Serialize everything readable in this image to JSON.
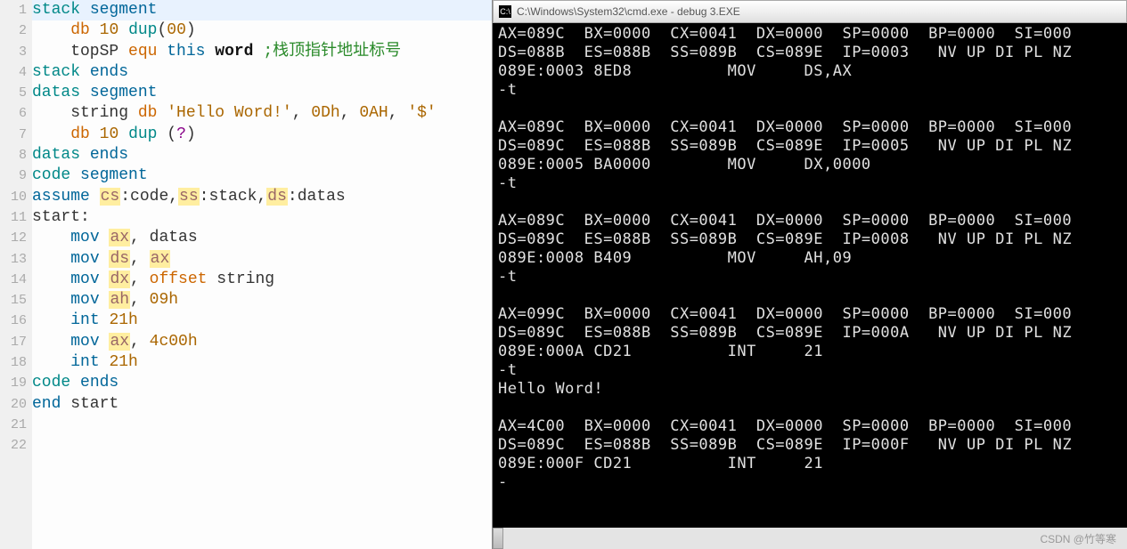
{
  "editor": {
    "gutter_start": 1,
    "gutter_count": 22,
    "lines": [
      {
        "hl": true,
        "tokens": [
          [
            "stack ",
            "kw-teal"
          ],
          [
            "segment",
            "kw-blue"
          ]
        ]
      },
      {
        "tokens": [
          [
            "    ",
            ""
          ],
          [
            "db",
            "kw-orange"
          ],
          [
            " ",
            ""
          ],
          [
            "10",
            "num"
          ],
          [
            " ",
            ""
          ],
          [
            "dup",
            "kw-teal"
          ],
          [
            "(",
            ""
          ],
          [
            "00",
            "num"
          ],
          [
            ")",
            ""
          ]
        ]
      },
      {
        "tokens": [
          [
            "    topSP ",
            ""
          ],
          [
            "equ",
            "kw-orange"
          ],
          [
            " ",
            ""
          ],
          [
            "this",
            "kw-blue"
          ],
          [
            " ",
            ""
          ],
          [
            "word",
            "kw-bold"
          ],
          [
            " ",
            ""
          ],
          [
            ";栈顶指针地址标号",
            "cmt"
          ]
        ]
      },
      {
        "tokens": [
          [
            "stack ",
            "kw-teal"
          ],
          [
            "ends",
            "kw-blue"
          ]
        ]
      },
      {
        "tokens": [
          [
            "datas ",
            "kw-teal"
          ],
          [
            "segment",
            "kw-blue"
          ]
        ]
      },
      {
        "tokens": [
          [
            "    string ",
            ""
          ],
          [
            "db",
            "kw-orange"
          ],
          [
            " ",
            ""
          ],
          [
            "'Hello Word!'",
            "str"
          ],
          [
            ", ",
            ""
          ],
          [
            "0Dh",
            "num"
          ],
          [
            ", ",
            ""
          ],
          [
            "0AH",
            "num"
          ],
          [
            ", ",
            ""
          ],
          [
            "'$'",
            "str"
          ]
        ]
      },
      {
        "tokens": [
          [
            "    ",
            ""
          ],
          [
            "db",
            "kw-orange"
          ],
          [
            " ",
            ""
          ],
          [
            "10",
            "num"
          ],
          [
            " ",
            ""
          ],
          [
            "dup",
            "kw-teal"
          ],
          [
            " (",
            ""
          ],
          [
            "?",
            "kw-purple"
          ],
          [
            ")",
            ""
          ]
        ]
      },
      {
        "tokens": [
          [
            "datas ",
            "kw-teal"
          ],
          [
            "ends",
            "kw-blue"
          ]
        ]
      },
      {
        "tokens": [
          [
            "code ",
            "kw-teal"
          ],
          [
            "segment",
            "kw-blue"
          ]
        ]
      },
      {
        "tokens": [
          [
            "assume",
            "kw-blue"
          ],
          [
            " ",
            ""
          ],
          [
            "cs",
            "hl-reg kw-brown"
          ],
          [
            ":code,",
            ""
          ],
          [
            "ss",
            "hl-reg kw-brown"
          ],
          [
            ":stack,",
            ""
          ],
          [
            "ds",
            "hl-reg kw-brown"
          ],
          [
            ":datas",
            ""
          ]
        ]
      },
      {
        "tokens": [
          [
            "start:",
            ""
          ]
        ]
      },
      {
        "tokens": [
          [
            "    ",
            ""
          ],
          [
            "mov",
            "kw-blue"
          ],
          [
            " ",
            ""
          ],
          [
            "ax",
            "hl-reg kw-brown"
          ],
          [
            ", datas",
            ""
          ]
        ]
      },
      {
        "tokens": [
          [
            "    ",
            ""
          ],
          [
            "mov",
            "kw-blue"
          ],
          [
            " ",
            ""
          ],
          [
            "ds",
            "hl-reg kw-brown"
          ],
          [
            ", ",
            ""
          ],
          [
            "ax",
            "hl-reg kw-brown"
          ]
        ]
      },
      {
        "tokens": [
          [
            "    ",
            ""
          ],
          [
            "mov",
            "kw-blue"
          ],
          [
            " ",
            ""
          ],
          [
            "dx",
            "hl-reg kw-brown"
          ],
          [
            ", ",
            ""
          ],
          [
            "offset",
            "kw-orange"
          ],
          [
            " string",
            ""
          ]
        ]
      },
      {
        "tokens": [
          [
            "    ",
            ""
          ],
          [
            "mov",
            "kw-blue"
          ],
          [
            " ",
            ""
          ],
          [
            "ah",
            "hl-reg kw-brown"
          ],
          [
            ", ",
            ""
          ],
          [
            "09h",
            "num"
          ]
        ]
      },
      {
        "tokens": [
          [
            "    ",
            ""
          ],
          [
            "int",
            "kw-blue"
          ],
          [
            " ",
            ""
          ],
          [
            "21h",
            "num"
          ]
        ]
      },
      {
        "tokens": [
          [
            "    ",
            ""
          ],
          [
            "mov",
            "kw-blue"
          ],
          [
            " ",
            ""
          ],
          [
            "ax",
            "hl-reg kw-brown"
          ],
          [
            ", ",
            ""
          ],
          [
            "4c00h",
            "num"
          ]
        ]
      },
      {
        "tokens": [
          [
            "    ",
            ""
          ],
          [
            "int",
            "kw-blue"
          ],
          [
            " ",
            ""
          ],
          [
            "21h",
            "num"
          ]
        ]
      },
      {
        "tokens": [
          [
            "code ",
            "kw-teal"
          ],
          [
            "ends",
            "kw-blue"
          ]
        ]
      },
      {
        "tokens": [
          [
            "end",
            "kw-blue"
          ],
          [
            " start",
            ""
          ]
        ]
      },
      {
        "tokens": [
          [
            "",
            ""
          ]
        ]
      },
      {
        "tokens": [
          [
            "",
            ""
          ]
        ]
      }
    ]
  },
  "console": {
    "title_icon_text": "C:\\",
    "title": "C:\\Windows\\System32\\cmd.exe - debug  3.EXE",
    "lines": [
      "AX=089C  BX=0000  CX=0041  DX=0000  SP=0000  BP=0000  SI=000",
      "DS=088B  ES=088B  SS=089B  CS=089E  IP=0003   NV UP DI PL NZ",
      "089E:0003 8ED8          MOV     DS,AX",
      "-t",
      "",
      "AX=089C  BX=0000  CX=0041  DX=0000  SP=0000  BP=0000  SI=000",
      "DS=089C  ES=088B  SS=089B  CS=089E  IP=0005   NV UP DI PL NZ",
      "089E:0005 BA0000        MOV     DX,0000",
      "-t",
      "",
      "AX=089C  BX=0000  CX=0041  DX=0000  SP=0000  BP=0000  SI=000",
      "DS=089C  ES=088B  SS=089B  CS=089E  IP=0008   NV UP DI PL NZ",
      "089E:0008 B409          MOV     AH,09",
      "-t",
      "",
      "AX=099C  BX=0000  CX=0041  DX=0000  SP=0000  BP=0000  SI=000",
      "DS=089C  ES=088B  SS=089B  CS=089E  IP=000A   NV UP DI PL NZ",
      "089E:000A CD21          INT     21",
      "-t",
      "Hello Word!",
      "",
      "AX=4C00  BX=0000  CX=0041  DX=0000  SP=0000  BP=0000  SI=000",
      "DS=089C  ES=088B  SS=089B  CS=089E  IP=000F   NV UP DI PL NZ",
      "089E:000F CD21          INT     21",
      "-"
    ]
  },
  "watermark": "CSDN @竹等寒"
}
